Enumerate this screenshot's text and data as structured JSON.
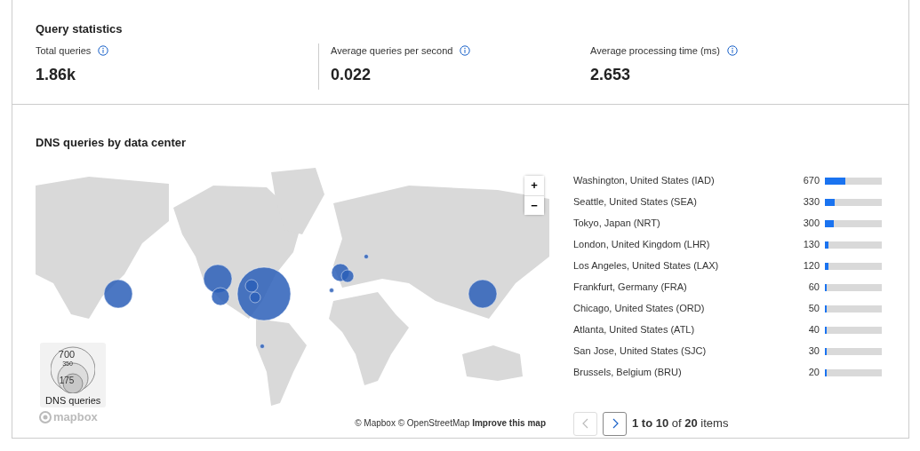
{
  "query_statistics": {
    "title": "Query statistics",
    "stats": [
      {
        "label": "Total queries",
        "value": "1.86k"
      },
      {
        "label": "Average queries per second",
        "value": "0.022"
      },
      {
        "label": "Average processing time (ms)",
        "value": "2.653"
      }
    ]
  },
  "dns_by_data_center": {
    "title": "DNS queries by data center",
    "map": {
      "zoom_in": "+",
      "zoom_out": "−",
      "legend": {
        "values": [
          "700",
          "350",
          "175"
        ],
        "title": "DNS queries"
      },
      "logo": "mapbox",
      "attribution": "© Mapbox © OpenStreetMap",
      "improve_link": "Improve this map"
    },
    "rows": [
      {
        "name": "Washington, United States (IAD)",
        "count": "670",
        "level": 0.36
      },
      {
        "name": "Seattle, United States (SEA)",
        "count": "330",
        "level": 0.17
      },
      {
        "name": "Tokyo, Japan (NRT)",
        "count": "300",
        "level": 0.16
      },
      {
        "name": "London, United Kingdom (LHR)",
        "count": "130",
        "level": 0.06
      },
      {
        "name": "Los Angeles, United States (LAX)",
        "count": "120",
        "level": 0.06
      },
      {
        "name": "Frankfurt, Germany (FRA)",
        "count": "60",
        "level": 0.03
      },
      {
        "name": "Chicago, United States (ORD)",
        "count": "50",
        "level": 0.02
      },
      {
        "name": "Atlanta, United States (ATL)",
        "count": "40",
        "level": 0.02
      },
      {
        "name": "San Jose, United States (SJC)",
        "count": "30",
        "level": 0.02
      },
      {
        "name": "Brussels, Belgium (BRU)",
        "count": "20",
        "level": 0.02
      }
    ],
    "pagination": {
      "previous_disabled": true,
      "next_disabled": false,
      "summary": "**1 to 10** of **20** items"
    }
  }
}
